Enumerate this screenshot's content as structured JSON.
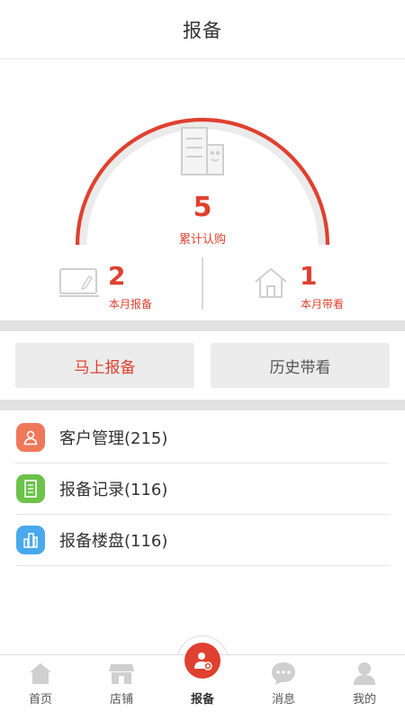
{
  "header": {
    "title": "报备"
  },
  "summary": {
    "total_value": "5",
    "total_label": "累计认购",
    "monthly_report_value": "2",
    "monthly_report_label": "本月报备",
    "monthly_visit_value": "1",
    "monthly_visit_label": "本月带看"
  },
  "actions": {
    "primary_label": "马上报备",
    "secondary_label": "历史带看"
  },
  "menu": [
    {
      "label": "客户管理(215)",
      "icon": "user-icon",
      "color": "#f0785a"
    },
    {
      "label": "报备记录(116)",
      "icon": "document-icon",
      "color": "#6cc24a"
    },
    {
      "label": "报备楼盘(116)",
      "icon": "building-icon",
      "color": "#4aa8ec"
    }
  ],
  "tabbar": {
    "items": [
      {
        "label": "首页",
        "icon": "home-icon"
      },
      {
        "label": "店铺",
        "icon": "store-icon"
      },
      {
        "label": "报备",
        "icon": "report-icon",
        "active": true
      },
      {
        "label": "消息",
        "icon": "message-icon"
      },
      {
        "label": "我的",
        "icon": "person-icon"
      }
    ]
  },
  "colors": {
    "accent": "#e0402f",
    "band": "#e2e2e2",
    "inactive_icon": "#cfcfcf"
  }
}
